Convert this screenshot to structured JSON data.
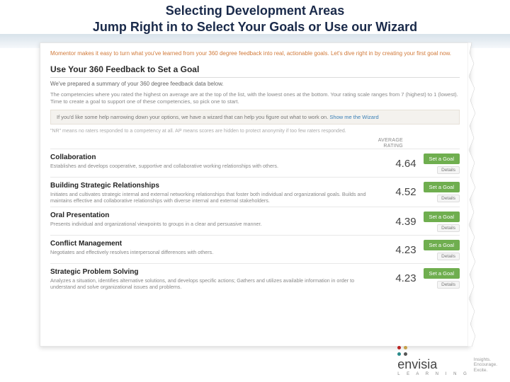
{
  "slide": {
    "title_line1": "Selecting Development Areas",
    "title_line2": "Jump Right in to Select Your Goals or Use our Wizard"
  },
  "intro": "Momentor makes it easy to turn what you've learned from your 360 degree feedback into real, actionable goals. Let's dive right in by creating your first goal now.",
  "section": {
    "heading": "Use Your 360 Feedback to Set a Goal",
    "sub": "We've prepared a summary of your 360 degree feedback data below.",
    "note": "The competencies where you rated the highest on average are at the top of the list, with the lowest ones at the bottom. Your rating scale ranges from 7 (highest) to 1 (lowest). Time to create a goal to support one of these competencies, so pick one to start."
  },
  "wizard": {
    "text": "If you'd like some help narrowing down your options, we have a wizard that can help you figure out what to work on.",
    "link": "Show me the Wizard"
  },
  "footnote": "\"NR\" means no raters responded to a competency at all. AP means scores are hidden to protect anonymity if too few raters responded.",
  "col_header": {
    "label1": "AVERAGE",
    "label2": "RATING"
  },
  "competencies": [
    {
      "name": "Collaboration",
      "desc": "Establishes and develops cooperative, supportive and collaborative working relationships with others.",
      "rating": "4.64",
      "btn": "Set a Goal",
      "detail": "Details"
    },
    {
      "name": "Building Strategic Relationships",
      "desc": "Initiates and cultivates strategic internal and external networking relationships that foster both individual and organizational goals. Builds and maintains effective and collaborative relationships with diverse internal and external stakeholders.",
      "rating": "4.52",
      "btn": "Set a Goal",
      "detail": "Details"
    },
    {
      "name": "Oral Presentation",
      "desc": "Presents individual and organizational viewpoints to groups in a clear and persuasive manner.",
      "rating": "4.39",
      "btn": "Set a Goal",
      "detail": "Details"
    },
    {
      "name": "Conflict Management",
      "desc": "Negotiates and effectively resolves interpersonal differences with others.",
      "rating": "4.23",
      "btn": "Set a Goal",
      "detail": "Details"
    },
    {
      "name": "Strategic Problem Solving",
      "desc": "Analyzes a situation, identifies alternative solutions, and develops specific actions; Gathers and utilizes available information in order to understand and solve organizational issues and problems.",
      "rating": "4.23",
      "btn": "Set a Goal",
      "detail": "Details"
    }
  ],
  "logo": {
    "brand": "envisia",
    "sub": "L E A R N I N G",
    "tag1": "Insights.",
    "tag2": "Encourage.",
    "tag3": "Excite."
  }
}
